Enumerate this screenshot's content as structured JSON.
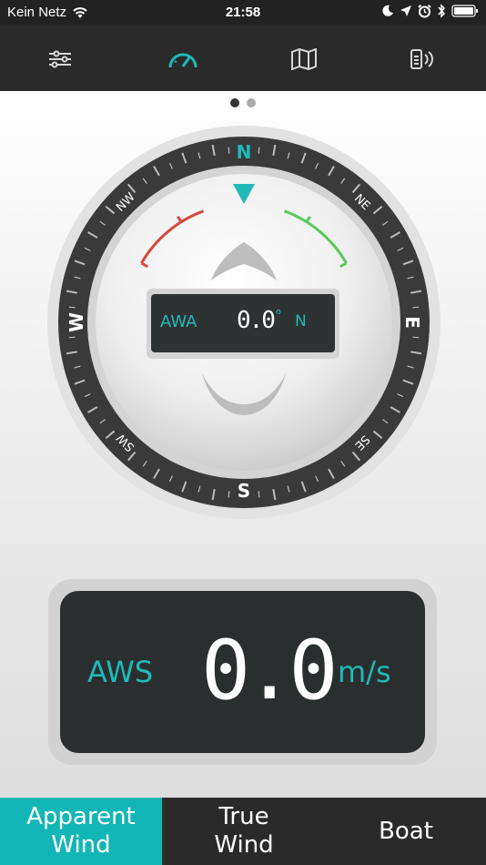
{
  "status_bar": {
    "carrier": "Kein Netz",
    "time": "21:58"
  },
  "toolbar": {
    "icons": [
      "sliders-icon",
      "gauge-icon",
      "map-icon",
      "battery-broadcast-icon"
    ],
    "active_index": 1
  },
  "page_indicator": {
    "pages": 2,
    "active": 0
  },
  "compass": {
    "cardinals": {
      "n": "N",
      "e": "E",
      "s": "S",
      "w": "W"
    },
    "intercardinals": {
      "ne": "NE",
      "se": "SE",
      "sw": "SW",
      "nw": "NW"
    }
  },
  "awa": {
    "label": "AWA",
    "value": "0.0",
    "degree": "°",
    "unit": "N"
  },
  "aws": {
    "label": "AWS",
    "value": "0.0",
    "unit": "m/s"
  },
  "tabs": [
    {
      "label": "Apparent Wind",
      "active": true
    },
    {
      "label": "True Wind",
      "active": false
    },
    {
      "label": "Boat",
      "active": false
    }
  ],
  "colors": {
    "accent": "#1fb9b9",
    "tab_active": "#13b6b6",
    "port": "#d9483b",
    "starboard": "#5cc85c",
    "bar": "#2a2a2a"
  }
}
